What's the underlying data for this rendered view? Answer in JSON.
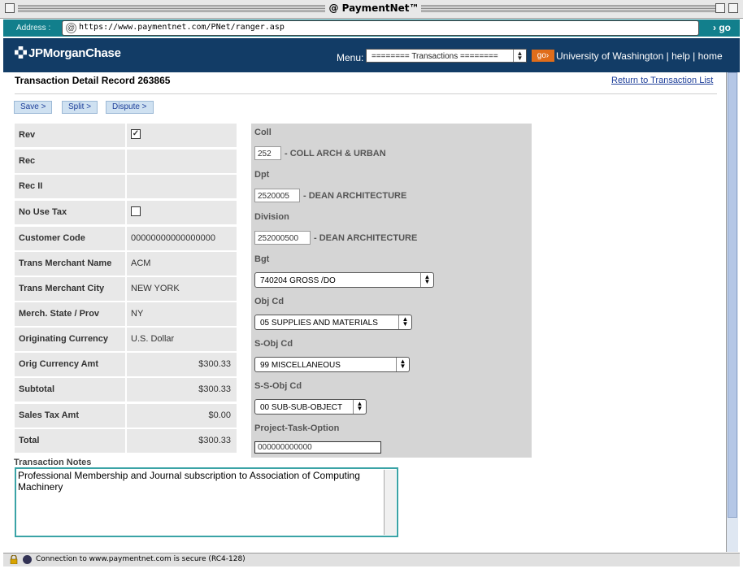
{
  "window": {
    "title": "@ PaymentNet™"
  },
  "address_bar": {
    "label": "Address :",
    "url": "https://www.paymentnet.com/PNet/ranger.asp",
    "go_label": "› go"
  },
  "header": {
    "logo_text": "JPMorganChase",
    "menu_label": "Menu:",
    "menu_selected": "======== Transactions ========",
    "menu_go": "go›",
    "org": "University of Washington",
    "help": "help",
    "home": "home",
    "sep": "|"
  },
  "record": {
    "title": "Transaction Detail Record 263865",
    "return_link": "Return to Transaction List"
  },
  "buttons": {
    "save": "Save >",
    "split": "Split >",
    "dispute": "Dispute >"
  },
  "fields": [
    {
      "label": "Rev",
      "value": "",
      "checkbox": true,
      "checked": true
    },
    {
      "label": "Rec",
      "value": ""
    },
    {
      "label": "Rec II",
      "value": ""
    },
    {
      "label": "No Use Tax",
      "value": "",
      "checkbox": true,
      "checked": false
    },
    {
      "label": "Customer Code",
      "value": "00000000000000000"
    },
    {
      "label": "Trans Merchant Name",
      "value": "ACM"
    },
    {
      "label": "Trans Merchant City",
      "value": "NEW YORK"
    },
    {
      "label": "Merch. State / Prov",
      "value": "NY"
    },
    {
      "label": "Originating Currency",
      "value": "U.S. Dollar"
    },
    {
      "label": "Orig Currency Amt",
      "value": "$300.33"
    },
    {
      "label": "Subtotal",
      "value": "$300.33"
    },
    {
      "label": "Sales Tax Amt",
      "value": "$0.00"
    },
    {
      "label": "Total",
      "value": "$300.33"
    }
  ],
  "accounting": {
    "coll": {
      "label": "Coll",
      "value": "252",
      "desc": "- COLL ARCH & URBAN"
    },
    "dpt": {
      "label": "Dpt",
      "value": "2520005",
      "desc": "- DEAN ARCHITECTURE"
    },
    "division": {
      "label": "Division",
      "value": "252000500",
      "desc": "- DEAN ARCHITECTURE"
    },
    "bgt": {
      "label": "Bgt",
      "selected": "740204 GROSS /DO"
    },
    "obj_cd": {
      "label": "Obj Cd",
      "selected": "05 SUPPLIES AND MATERIALS"
    },
    "s_obj_cd": {
      "label": "S-Obj Cd",
      "selected": "99 MISCELLANEOUS"
    },
    "s_s_obj_cd": {
      "label": "S-S-Obj Cd",
      "selected": "00 SUB-SUB-OBJECT"
    },
    "project": {
      "label": "Project-Task-Option",
      "value": "000000000000"
    }
  },
  "notes": {
    "label": "Transaction Notes",
    "text": "Professional Membership and Journal subscription to Association of Computing Machinery"
  },
  "status": {
    "text": "Connection to www.paymentnet.com is secure (RC4-128)"
  },
  "colors": {
    "header": "#123c66",
    "address_bar": "#127f8c",
    "go_orange": "#e06d1a",
    "panel_gray": "#d5d5d5",
    "cell_gray": "#e8e8e8"
  }
}
